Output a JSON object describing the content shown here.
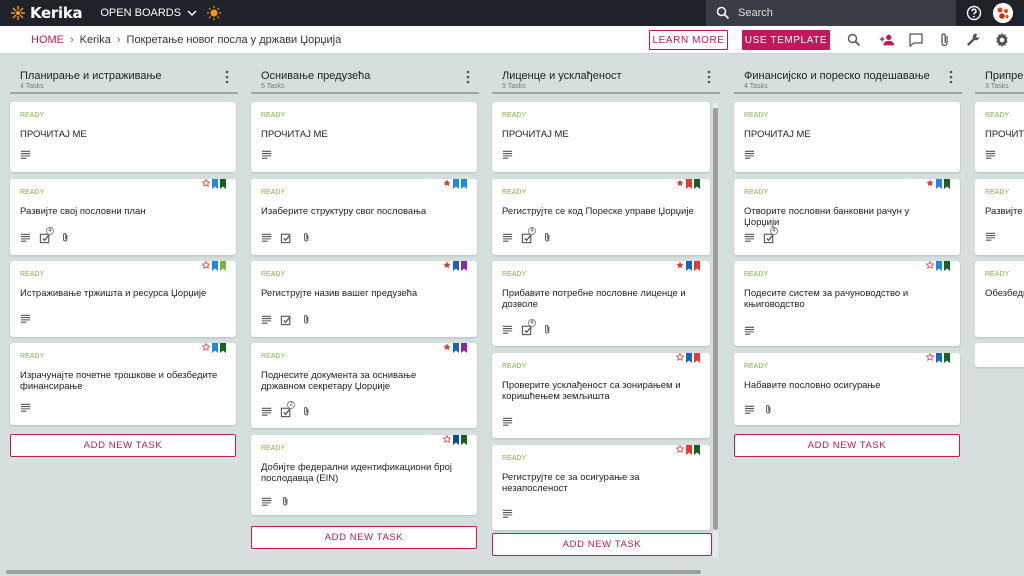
{
  "app": {
    "name": "Kerika",
    "open_boards": "OPEN BOARDS"
  },
  "search": {
    "placeholder": "Search"
  },
  "breadcrumb": {
    "home": "HOME",
    "account": "Kerika",
    "board": "Покретање новог посла у држави Џорџија"
  },
  "actions": {
    "learn_more": "LEARN MORE",
    "use_template": "USE TEMPLATE"
  },
  "colors": {
    "accent": "#c2185b",
    "ready": "#7cb342",
    "topbar": "#1f2228",
    "board_bg": "#d5e0de"
  },
  "columns": [
    {
      "title": "Планирање и истраживање",
      "count": "4 Tasks",
      "add_label": "ADD NEW TASK",
      "cards": [
        {
          "status": "READY",
          "title": "ПРОЧИТАЈ МЕ"
        },
        {
          "status": "READY",
          "title": "Развијте свој пословни план",
          "badge": "4"
        },
        {
          "status": "READY",
          "title": "Истраживање тржишта и ресурса Џорџије"
        },
        {
          "status": "READY",
          "title": "Израчунајте почетне трошкове и обезбедите финансирање"
        }
      ]
    },
    {
      "title": "Оснивање предузећа",
      "count": "5 Tasks",
      "add_label": "ADD NEW TASK",
      "cards": [
        {
          "status": "READY",
          "title": "ПРОЧИТАЈ МЕ"
        },
        {
          "status": "READY",
          "title": "Изаберите структуру свог пословања"
        },
        {
          "status": "READY",
          "title": "Региструјте назив вашег предузећа"
        },
        {
          "status": "READY",
          "title": "Поднесите документа за оснивање државном секретару Џорџије",
          "badge": "2"
        },
        {
          "status": "READY",
          "title": "Добијте федерални идентификациони број послодавца (EIN)"
        }
      ]
    },
    {
      "title": "Лиценце и усклађеност",
      "count": "5 Tasks",
      "add_label": "ADD NEW TASK",
      "cards": [
        {
          "status": "READY",
          "title": "ПРОЧИТАЈ МЕ"
        },
        {
          "status": "READY",
          "title": "Региструјте се код Пореске управе Џорџије",
          "badge": "4"
        },
        {
          "status": "READY",
          "title": "Прибавите потребне пословне лиценце и дозволе",
          "badge": "4"
        },
        {
          "status": "READY",
          "title": "Проверите усклађеност са зонирањем и коришћењем земљишта"
        },
        {
          "status": "READY",
          "title": "Региструјте се за осигурање за незапосленост"
        }
      ]
    },
    {
      "title": "Финансијско и пореско подешавање",
      "count": "4 Tasks",
      "add_label": "ADD NEW TASK",
      "cards": [
        {
          "status": "READY",
          "title": "ПРОЧИТАЈ МЕ"
        },
        {
          "status": "READY",
          "title": "Отворите пословни банковни рачун у Џорџији",
          "badge": "4"
        },
        {
          "status": "READY",
          "title": "Подесите систем за рачуноводство и књиговодство"
        },
        {
          "status": "READY",
          "title": "Набавите пословно осигурање"
        }
      ]
    },
    {
      "title": "Припрем",
      "count": "3 Tasks",
      "cards": [
        {
          "status": "READY",
          "title": "ПРОЧИТ"
        },
        {
          "status": "READY",
          "title": "Развијте"
        },
        {
          "status": "READY",
          "title": "Обезбеди"
        }
      ]
    }
  ]
}
